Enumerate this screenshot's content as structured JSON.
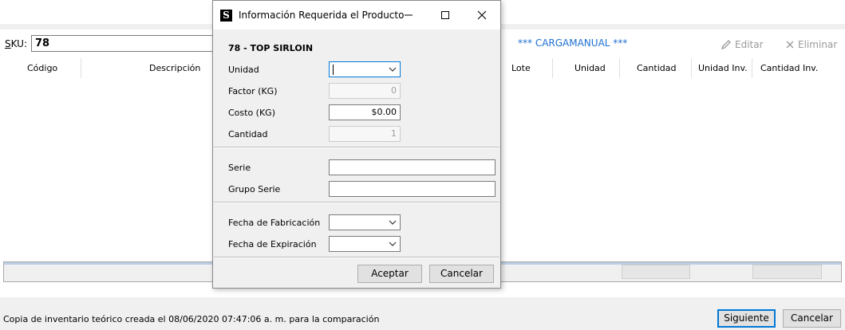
{
  "background": {
    "sku_label": "SKU:",
    "sku_value": "78",
    "carga_text": "*** CARGAMANUAL ***",
    "toolbar": {
      "edit_label": "Editar",
      "delete_label": "Eliminar"
    },
    "columns": [
      "Código",
      "Descripción",
      "Lote",
      "Unidad",
      "Cantidad",
      "Unidad Inv.",
      "Cantidad Inv."
    ],
    "status_text": "Copia de inventario teórico creada el 08/06/2020 07:47:06 a. m. para la comparación",
    "next_label": "Siguiente",
    "cancel_label": "Cancelar"
  },
  "dialog": {
    "title": "Información Requerida el Producto",
    "app_icon_letter": "S",
    "product": "78 - TOP SIRLOIN",
    "fields": {
      "unidad_label": "Unidad",
      "unidad_value": "",
      "factor_label": "Factor (KG)",
      "factor_value": "0",
      "costo_label": "Costo (KG)",
      "costo_value": "$0.00",
      "cantidad_label": "Cantidad",
      "cantidad_value": "1",
      "serie_label": "Serie",
      "serie_value": "",
      "grupo_serie_label": "Grupo Serie",
      "grupo_serie_value": "",
      "fecha_fab_label": "Fecha de Fabricación",
      "fecha_fab_value": "",
      "fecha_exp_label": "Fecha de Expiración",
      "fecha_exp_value": ""
    },
    "accept_label": "Aceptar",
    "cancel_label": "Cancelar"
  },
  "colors": {
    "accent": "#0078d7",
    "carga_blue": "#1e6fd0"
  }
}
